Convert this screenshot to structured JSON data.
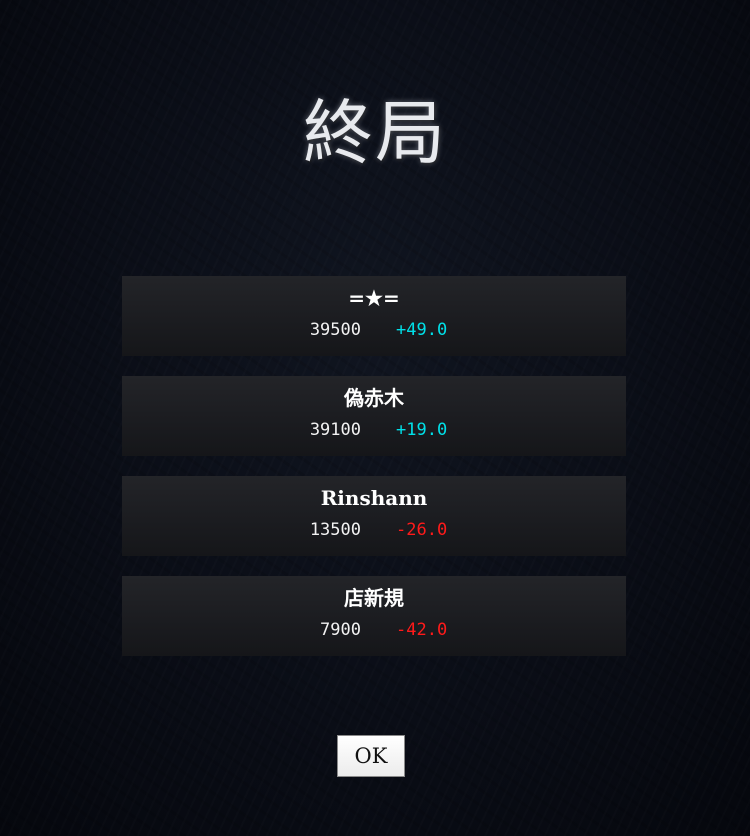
{
  "screen": {
    "title": "終局"
  },
  "players": [
    {
      "name": "=★=",
      "points": "39500",
      "delta": "+49.0",
      "delta_color": "#00e0e8"
    },
    {
      "name": "偽赤木",
      "points": "39100",
      "delta": "+19.0",
      "delta_color": "#00e0e8"
    },
    {
      "name": "Rinshann",
      "points": "13500",
      "delta": "-26.0",
      "delta_color": "#ff1a1a"
    },
    {
      "name": "店新規",
      "points": "7900",
      "delta": "-42.0",
      "delta_color": "#ff1a1a"
    }
  ],
  "buttons": {
    "ok_label": "OK"
  }
}
